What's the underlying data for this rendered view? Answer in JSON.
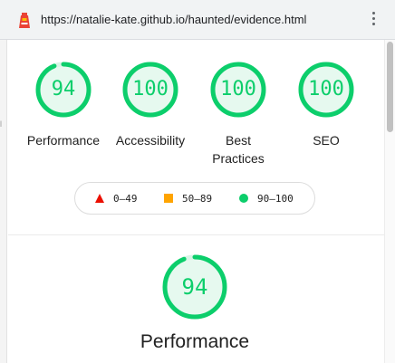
{
  "browser": {
    "url": "https://natalie-kate.github.io/haunted/evidence.html",
    "favicon": "lighthouse-icon",
    "menu_icon": "kebab-menu-icon"
  },
  "theme": {
    "pass_color": "#0cce6b",
    "average_color": "#ffa400",
    "fail_color": "#ff4e42"
  },
  "gauges": [
    {
      "score": "94",
      "label": "Performance",
      "fraction": 0.94
    },
    {
      "score": "100",
      "label": "Accessibility",
      "fraction": 1.0
    },
    {
      "score": "100",
      "label_line1": "Best",
      "label_line2": "Practices",
      "fraction": 1.0
    },
    {
      "score": "100",
      "label": "SEO",
      "fraction": 1.0
    }
  ],
  "legend": {
    "fail": {
      "range": "0–49",
      "icon": "triangle-icon"
    },
    "average": {
      "range": "50–89",
      "icon": "square-icon"
    },
    "pass": {
      "range": "90–100",
      "icon": "circle-icon"
    }
  },
  "performance_section": {
    "score": "94",
    "fraction": 0.94,
    "title": "Performance"
  }
}
